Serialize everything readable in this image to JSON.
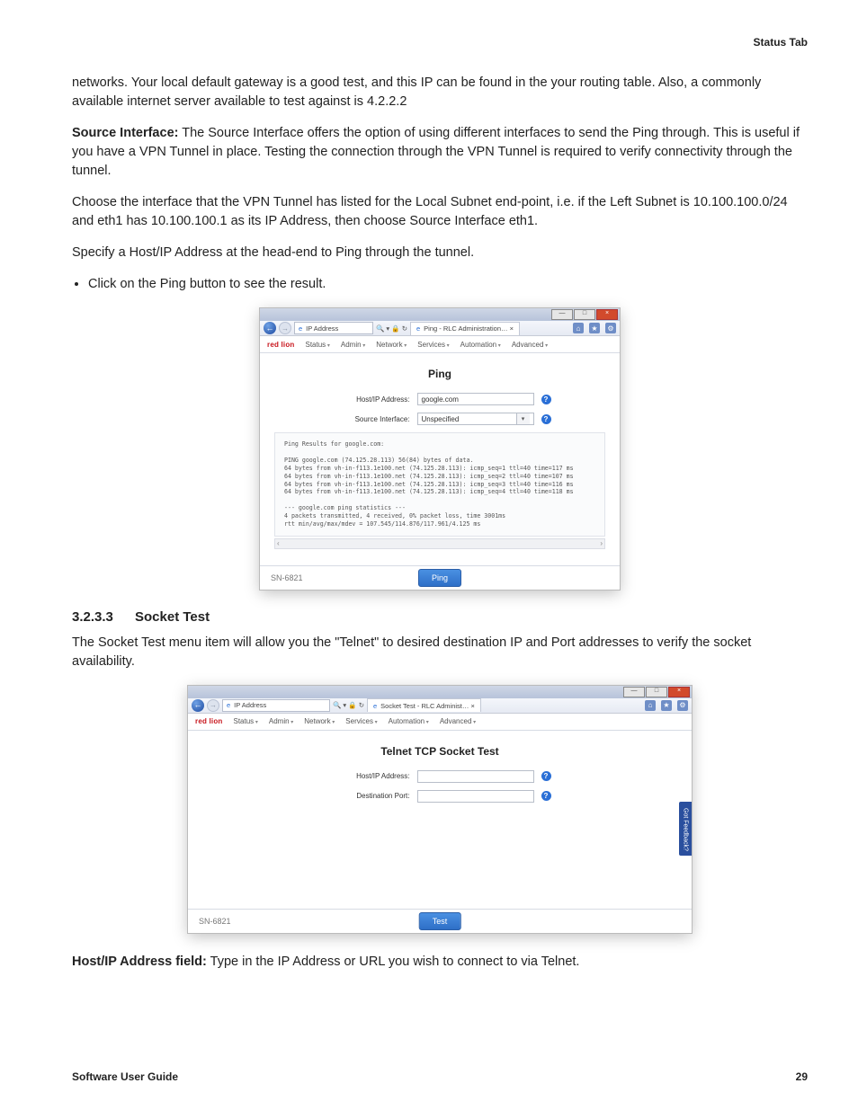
{
  "header": {
    "right": "Status Tab"
  },
  "paras": {
    "p1": "networks. Your local default gateway is a good test, and this IP can be found in the your routing table. Also, a commonly available internet server available to test against is 4.2.2.2",
    "p2_label": "Source Interface:",
    "p2_body": " The Source Interface offers the option of using different interfaces to send the Ping through. This is useful if you have a VPN Tunnel in place. Testing the connection through the VPN Tunnel is required to verify connectivity through the tunnel.",
    "p3": "Choose the interface that the VPN Tunnel has listed for the Local Subnet end-point, i.e. if the Left Subnet is 10.100.100.0/24 and eth1 has 10.100.100.1 as its IP Address, then choose Source Interface eth1.",
    "p4": "Specify a Host/IP Address at the head-end to Ping through the tunnel.",
    "bullet1": "Click on the Ping button to see the result."
  },
  "section": {
    "num": "3.2.3.3",
    "title": "Socket Test"
  },
  "paras2": {
    "p5": "The Socket Test menu item will allow you the \"Telnet\" to desired destination IP and Port addresses to verify the socket availability.",
    "p6_label": "Host/IP Address field:",
    "p6_body": " Type in the IP Address or URL you wish to connect to via Telnet."
  },
  "footer": {
    "left": "Software User Guide",
    "right": "29"
  },
  "browser_common": {
    "logo": "red lion",
    "menu": [
      "Status",
      "Admin",
      "Network",
      "Services",
      "Automation",
      "Advanced"
    ],
    "title_btn_min": "—",
    "title_btn_max": "□",
    "title_btn_close": "×",
    "url_label": "IP Address",
    "url_tools": "🔍 ▾  🔒 ↻",
    "tool_home": "⌂",
    "tool_star": "★",
    "tool_gear": "⚙"
  },
  "shot1": {
    "tab_title": "Ping - RLC Administration…  ×",
    "panel_title": "Ping",
    "row1_label": "Host/IP Address:",
    "row1_value": "google.com",
    "row2_label": "Source Interface:",
    "row2_value": "Unspecified",
    "console": "Ping Results for google.com:\n\nPING google.com (74.125.28.113) 56(84) bytes of data.\n64 bytes from vh-in-f113.1e100.net (74.125.28.113): icmp_seq=1 ttl=40 time=117 ms\n64 bytes from vh-in-f113.1e100.net (74.125.28.113): icmp_seq=2 ttl=40 time=107 ms\n64 bytes from vh-in-f113.1e100.net (74.125.28.113): icmp_seq=3 ttl=40 time=116 ms\n64 bytes from vh-in-f113.1e100.net (74.125.28.113): icmp_seq=4 ttl=40 time=118 ms\n\n--- google.com ping statistics ---\n4 packets transmitted, 4 received, 0% packet loss, time 3001ms\nrtt min/avg/max/mdev = 107.545/114.876/117.961/4.125 ms",
    "scroll_left": "‹",
    "scroll_right": "›",
    "device": "SN-6821",
    "button": "Ping"
  },
  "shot2": {
    "tab_title": "Socket Test - RLC Administ…  ×",
    "panel_title": "Telnet TCP Socket Test",
    "row1_label": "Host/IP Address:",
    "row1_value": "",
    "row2_label": "Destination Port:",
    "row2_value": "",
    "device": "SN-6821",
    "button": "Test",
    "feedback": "Got Feedback?"
  }
}
